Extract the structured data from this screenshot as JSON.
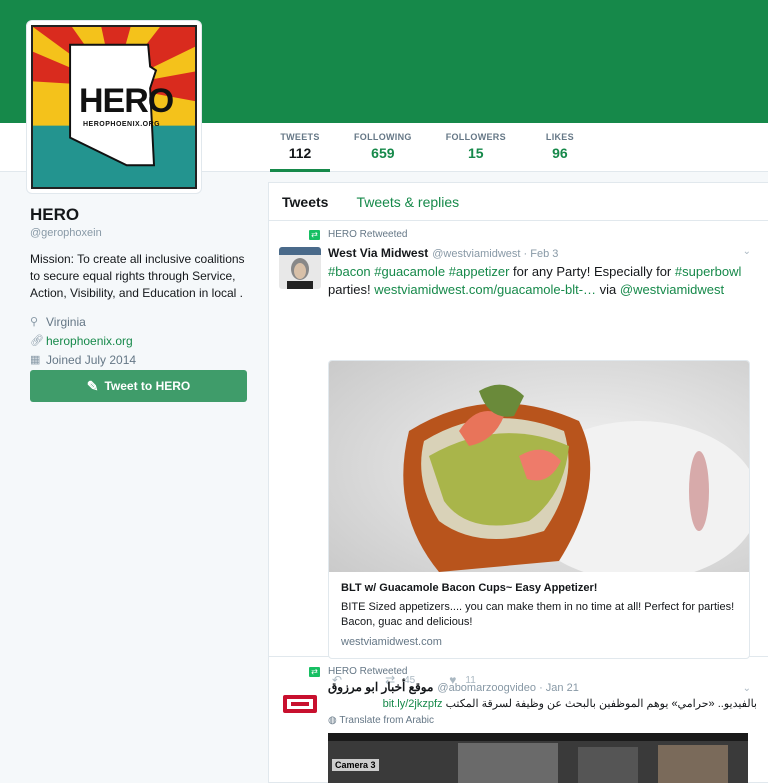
{
  "profile": {
    "avatar_text": "HERO",
    "avatar_subtext": "HEROPHOENIX.ORG",
    "name": "HERO",
    "handle": "@gerophoxein",
    "bio": "Mission: To create all inclusive coalitions to secure equal rights through Service, Action, Visibility, and Education in local .",
    "location": "Virginia",
    "website": "herophoenix.org",
    "joined": "Joined July 2014",
    "tweet_to_label": "Tweet to HERO"
  },
  "stats": [
    {
      "label": "TWEETS",
      "value": "112"
    },
    {
      "label": "FOLLOWING",
      "value": "659"
    },
    {
      "label": "FOLLOWERS",
      "value": "15"
    },
    {
      "label": "LIKES",
      "value": "96"
    }
  ],
  "timeline": {
    "tabs": [
      "Tweets",
      "Tweets & replies"
    ],
    "tweets": [
      {
        "retweeted_by": "HERO Retweeted",
        "name": "West Via Midwest",
        "handle": "@westviamidwest · Feb 3",
        "text_parts": {
          "hashtags1": "#bacon #guacamole #appetizer",
          "text1": " for any Party!  Especially for",
          "hashtag2": "#superbowl",
          "text2": " parties!  ",
          "link": "westviamidwest.com/guacamole-blt-…",
          "text3": " via",
          "mention": "@westviamidwest"
        },
        "card": {
          "title": "BLT w/ Guacamole Bacon Cups~ Easy Appetizer!",
          "description": "BITE Sized appetizers.... you can make them in no time at all! Perfect for parties! Bacon, guac and delicious!",
          "url": "westviamidwest.com"
        },
        "retweets": "45",
        "likes": "11"
      },
      {
        "retweeted_by": "HERO Retweeted",
        "name": "موقع أخبار ابو مرزوق",
        "handle": "@abomarzoogvideo · Jan 21",
        "text": "بالفيديو.. «حرامي» يوهم الموظفين بالبحث عن وظيفة لسرقة المكتب",
        "link": "bit.ly/2jkzpfz",
        "translate": "Translate from Arabic",
        "video_label": "Camera 3"
      }
    ]
  },
  "colors": {
    "banner": "#16894a",
    "accent": "#16894a",
    "button": "#3f9c6a"
  }
}
